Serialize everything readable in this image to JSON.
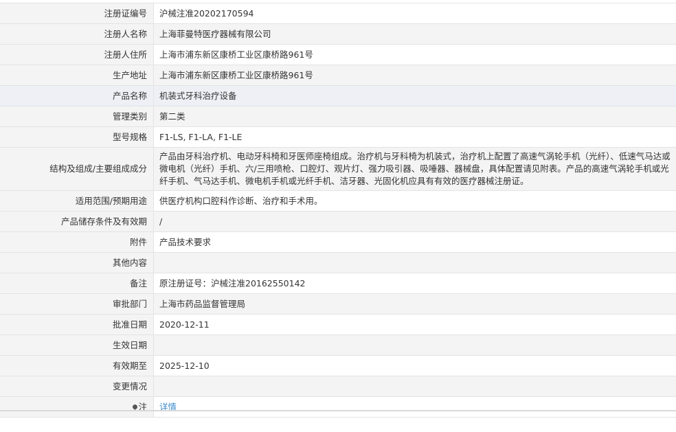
{
  "rows": [
    {
      "label": "注册证编号",
      "value": "沪械注准20202170594"
    },
    {
      "label": "注册人名称",
      "value": "上海菲曼特医疗器械有限公司"
    },
    {
      "label": "注册人住所",
      "value": "上海市浦东新区康桥工业区康桥路961号"
    },
    {
      "label": "生产地址",
      "value": "上海市浦东新区康桥工业区康桥路961号"
    },
    {
      "label": "产品名称",
      "value": "机装式牙科治疗设备"
    },
    {
      "label": "管理类别",
      "value": "第二类"
    },
    {
      "label": "型号规格",
      "value": "F1-LS, F1-LA, F1-LE"
    },
    {
      "label": "结构及组成/主要组成成分",
      "value": "产品由牙科治疗机、电动牙科椅和牙医师座椅组成。治疗机与牙科椅为机装式，治疗机上配置了高速气涡轮手机（光纤）、低速气马达或微电机（光纤）手机、六/三用喷枪、口腔灯、观片灯、强力吸引器、吸唾器、器械盘，具体配置请见附表。产品的高速气涡轮手机或光纤手机、气马达手机、微电机手机或光纤手机、洁牙器、光固化机应具有有效的医疗器械注册证。"
    },
    {
      "label": "适用范围/预期用途",
      "value": "供医疗机构口腔科作诊断、治疗和手术用。"
    },
    {
      "label": "产品储存条件及有效期",
      "value": "/"
    },
    {
      "label": "附件",
      "value": "产品技术要求"
    },
    {
      "label": "其他内容",
      "value": ""
    },
    {
      "label": "备注",
      "value": "原注册证号：沪械注准20162550142"
    },
    {
      "label": "审批部门",
      "value": "上海市药品监督管理局"
    },
    {
      "label": "批准日期",
      "value": "2020-12-11"
    },
    {
      "label": "生效日期",
      "value": ""
    },
    {
      "label": "有效期至",
      "value": "2025-12-10"
    },
    {
      "label": "变更情况",
      "value": ""
    }
  ],
  "note_row": {
    "label": "注",
    "link_text": "详情"
  },
  "icons": {
    "note": "pin-icon"
  },
  "colors": {
    "link": "#3f8ecf",
    "label_bg": "#f4f4f4",
    "highlight_bg": "#eef0f6",
    "border": "#e3e3e3"
  }
}
